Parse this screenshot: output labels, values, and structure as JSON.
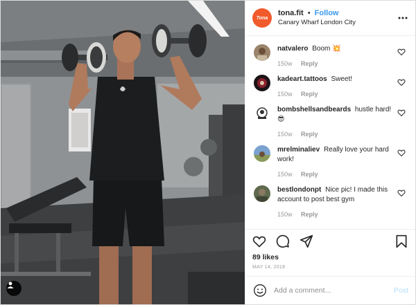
{
  "post": {
    "username": "tona.fit",
    "separator": "•",
    "follow_label": "Follow",
    "location": "Canary Wharf London City",
    "brand_avatar_text": "Tona",
    "likes": "89 likes",
    "date": "MAY 14, 2018"
  },
  "comments": [
    {
      "username": "natvalero",
      "text": "Boom 💥",
      "age": "150w",
      "reply_label": "Reply",
      "avatar_color": "#8a6f56"
    },
    {
      "username": "kadeart.tattoos",
      "text": "Sweet!",
      "age": "150w",
      "reply_label": "Reply",
      "avatar_color": "#7b1e2a"
    },
    {
      "username": "bombshellsandbeards",
      "text": "hustle hard! 😎",
      "age": "150w",
      "reply_label": "Reply",
      "avatar_color": "#ffffff"
    },
    {
      "username": "mrelminaliev",
      "text": "Really love your hard work!",
      "age": "150w",
      "reply_label": "Reply",
      "avatar_color": "#6f8fb8"
    },
    {
      "username": "bestlondonpt",
      "text": "Nice pic! I made this account to post best gym",
      "age": "150w",
      "reply_label": "Reply",
      "avatar_color": "#6d7a5a"
    }
  ],
  "icons": {
    "more": "more-options-icon",
    "heart": "heart-icon",
    "comment": "comment-icon",
    "share": "share-icon",
    "bookmark": "bookmark-icon",
    "emoji": "emoji-icon",
    "tag": "user-tag-icon"
  },
  "add_comment": {
    "placeholder": "Add a comment...",
    "post_label": "Post"
  },
  "colors": {
    "accent": "#3897f0",
    "brand": "#f15a2b",
    "post_disabled": "#b2dffc"
  }
}
